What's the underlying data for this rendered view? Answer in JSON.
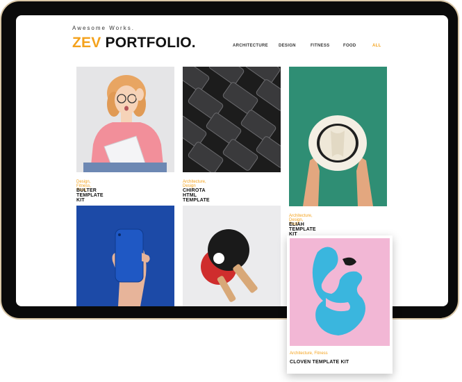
{
  "header": {
    "tagline": "Awesome Works.",
    "logo_accent": "ZEV",
    "logo_main": "PORTFOLIO."
  },
  "nav": {
    "items": [
      "ARCHITECTURE",
      "DESIGN",
      "FITNESS",
      "FOOD",
      "ALL"
    ],
    "active": "ALL"
  },
  "colors": {
    "accent": "#f4a21c",
    "text": "#111111",
    "device_frame": "#0a0a0a",
    "device_border": "#d8c6a6"
  },
  "portfolio": [
    {
      "categories": "Design, Fitness, Food",
      "title": "BULTER TEMPLATE KIT"
    },
    {
      "categories": "Architecture, Design",
      "title": "CHIROTA HTML TEMPLATE"
    },
    {
      "categories": "Architecture, Design, Food",
      "title": "ELIAH TEMPLATE KIT"
    },
    {
      "categories": "Architecture, Fitness",
      "title": "CLOVEN TEMPLATE KIT"
    }
  ]
}
